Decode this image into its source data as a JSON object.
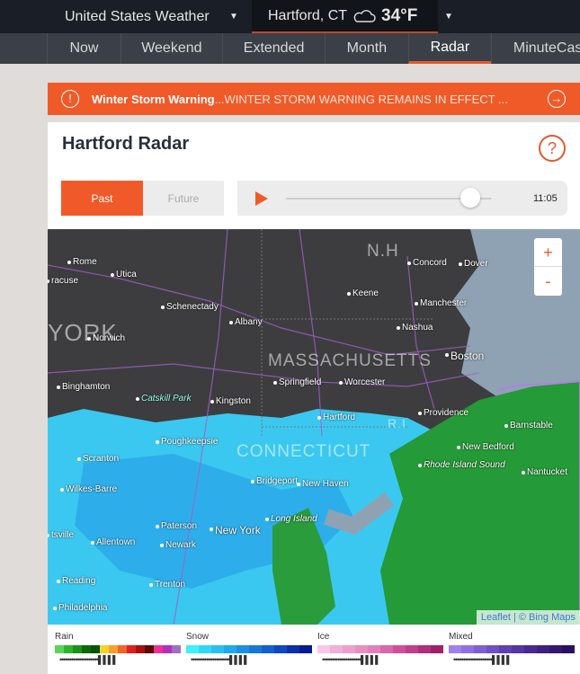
{
  "header": {
    "site": "United States Weather",
    "location": "Hartford, CT",
    "temp": "34°F",
    "weather_icon": "cloud-icon"
  },
  "nav": [
    {
      "label": "Now"
    },
    {
      "label": "Weekend"
    },
    {
      "label": "Extended"
    },
    {
      "label": "Month"
    },
    {
      "label": "Radar",
      "active": true
    },
    {
      "label": "MinuteCast"
    }
  ],
  "alert": {
    "title": "Winter Storm Warning",
    "text": " ...WINTER STORM WARNING REMAINS IN EFFECT ..."
  },
  "radar": {
    "title": "Hartford Radar",
    "help": "?",
    "past": "Past",
    "future": "Future",
    "time": "11:05",
    "progress": 0.9
  },
  "map": {
    "zoom_in": "+",
    "zoom_out": "-",
    "attribution_leaflet": "Leaflet",
    "attribution_rest": " | © Bing Maps",
    "states": [
      "MASSACHUSETTS",
      "CONNECTICUT",
      "YORK",
      "N.H",
      "R.I"
    ],
    "cities": [
      "Rome",
      "Utica",
      "racuse",
      "Concord",
      "Dover",
      "Keene",
      "Manchester",
      "Schenectady",
      "Albany",
      "Nashua",
      "Norwich",
      "Boston",
      "Springfield",
      "Worcester",
      "Binghamton",
      "Catskill Park",
      "Kingston",
      "Hartford",
      "Providence",
      "Barnstable",
      "Poughkeepsie",
      "New Bedford",
      "Scranton",
      "Nantucket",
      "Bridgeport",
      "New Haven",
      "Rhode Island Sound",
      "Wilkes-Barre",
      "Long Island",
      "Paterson",
      "New York",
      "Newark",
      "Allentown",
      "tsville",
      "Reading",
      "Trenton",
      "Philadelphia"
    ]
  },
  "legend": [
    {
      "name": "Rain",
      "colors": [
        "#5bd35b",
        "#2db52d",
        "#1c8f1c",
        "#0b6b0b",
        "#075507",
        "#f5d22a",
        "#f5a02a",
        "#f0632a",
        "#e02020",
        "#a81010",
        "#5a0808",
        "#f03090",
        "#b030c0",
        "#a070c0"
      ]
    },
    {
      "name": "Snow",
      "colors": [
        "#40f0f8",
        "#30d8f5",
        "#28c0f0",
        "#20a8ea",
        "#1c90e0",
        "#1878d8",
        "#1460d0",
        "#1048c0",
        "#0c30a8",
        "#081c90"
      ]
    },
    {
      "name": "Ice",
      "colors": [
        "#f8c8e8",
        "#f0b0d8",
        "#eca0cc",
        "#e890c0",
        "#e080b8",
        "#d868a8",
        "#d05098",
        "#c04088",
        "#b03078",
        "#a02068"
      ]
    },
    {
      "name": "Mixed",
      "colors": [
        "#a080f0",
        "#9070e0",
        "#8060d0",
        "#7050c0",
        "#6040b0",
        "#5535a0",
        "#4a2a90",
        "#3f2080",
        "#341870",
        "#2a1060"
      ]
    }
  ]
}
